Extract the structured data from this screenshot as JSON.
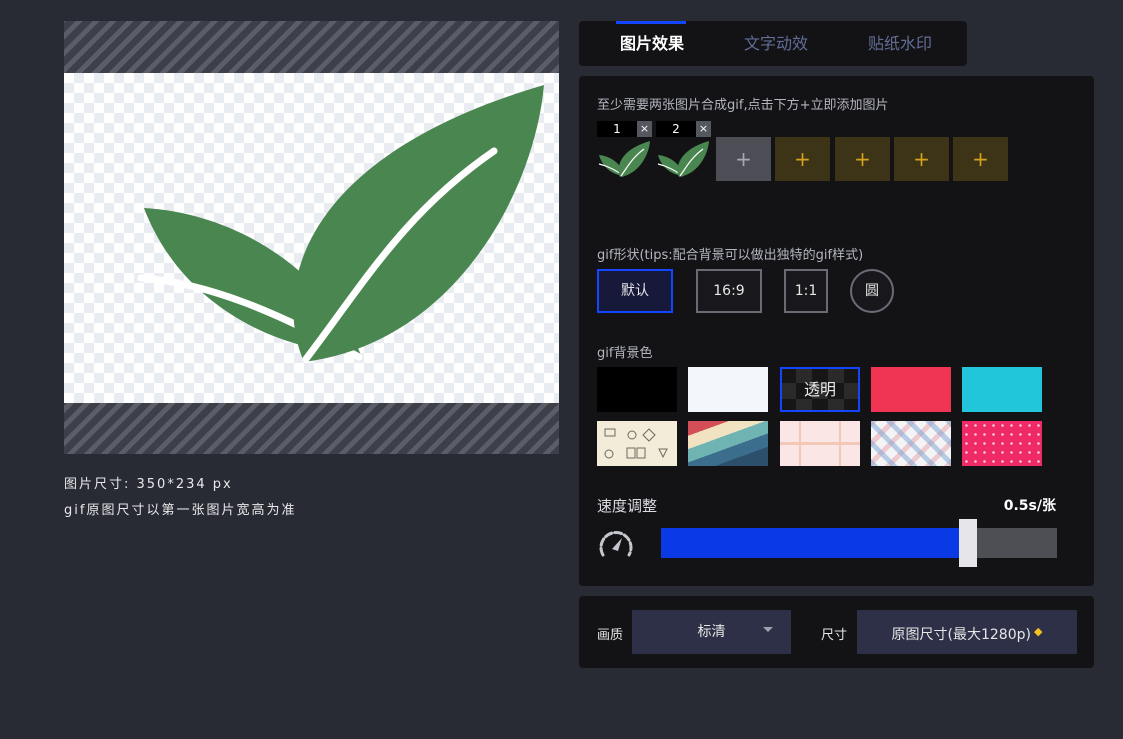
{
  "preview": {
    "size_info": "图片尺寸: 350*234 px",
    "size_note": "gif原图尺寸以第一张图片宽高为准"
  },
  "tabs": [
    {
      "label": "图片效果",
      "active": true
    },
    {
      "label": "文字动效",
      "active": false
    },
    {
      "label": "贴纸水印",
      "active": false
    }
  ],
  "upload": {
    "hint": "至少需要两张图片合成gif,点击下方+立即添加图片",
    "images": [
      {
        "number": "1",
        "delete_label": "×",
        "icon": "leaf-icon"
      },
      {
        "number": "2",
        "delete_label": "×",
        "icon": "leaf-icon"
      }
    ],
    "add_label": "+"
  },
  "shape": {
    "label": "gif形状(tips:配合背景可以做出独特的gif样式)",
    "options": [
      "默认",
      "16:9",
      "1:1",
      "圆"
    ],
    "selected": "默认"
  },
  "background": {
    "label": "gif背景色",
    "transparent_label": "透明",
    "colors": {
      "black": "#000000",
      "white": "#f3f6fb",
      "red": "#f03453",
      "cyan": "#22c6da"
    },
    "selected": "透明"
  },
  "speed": {
    "label": "速度调整",
    "value": "0.5s/张",
    "level_percent": 77.5
  },
  "output": {
    "quality_label": "画质",
    "quality_value": "标清",
    "size_label": "尺寸",
    "size_value": "原图尺寸(最大1280p)"
  },
  "colors": {
    "accent": "#1446ff",
    "leaf": "#4a8650",
    "slider_fill": "#0a3ae5",
    "add_slot": "#d4a31e"
  }
}
